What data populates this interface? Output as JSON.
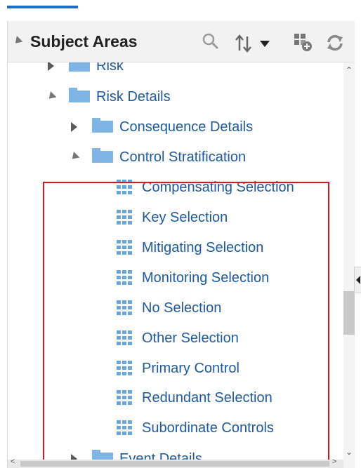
{
  "panel": {
    "title": "Subject Areas"
  },
  "header_icons": [
    "search-icon",
    "sort-icon",
    "dropdown-icon",
    "add-subject-area-icon",
    "refresh-icon"
  ],
  "tree": {
    "risk": "Risk",
    "risk_details": "Risk Details",
    "consequence_details": "Consequence Details",
    "control_stratification": "Control Stratification",
    "children": [
      "Compensating Selection",
      "Key Selection",
      "Mitigating Selection",
      "Monitoring Selection",
      "No Selection",
      "Other Selection",
      "Primary Control",
      "Redundant Selection",
      "Subordinate Controls"
    ],
    "event_details": "Event Details"
  },
  "colors": {
    "accent": "#1f6fbf",
    "link": "#1f5aa0",
    "folder": "#7fb4e6",
    "highlight": "#e0121e"
  }
}
